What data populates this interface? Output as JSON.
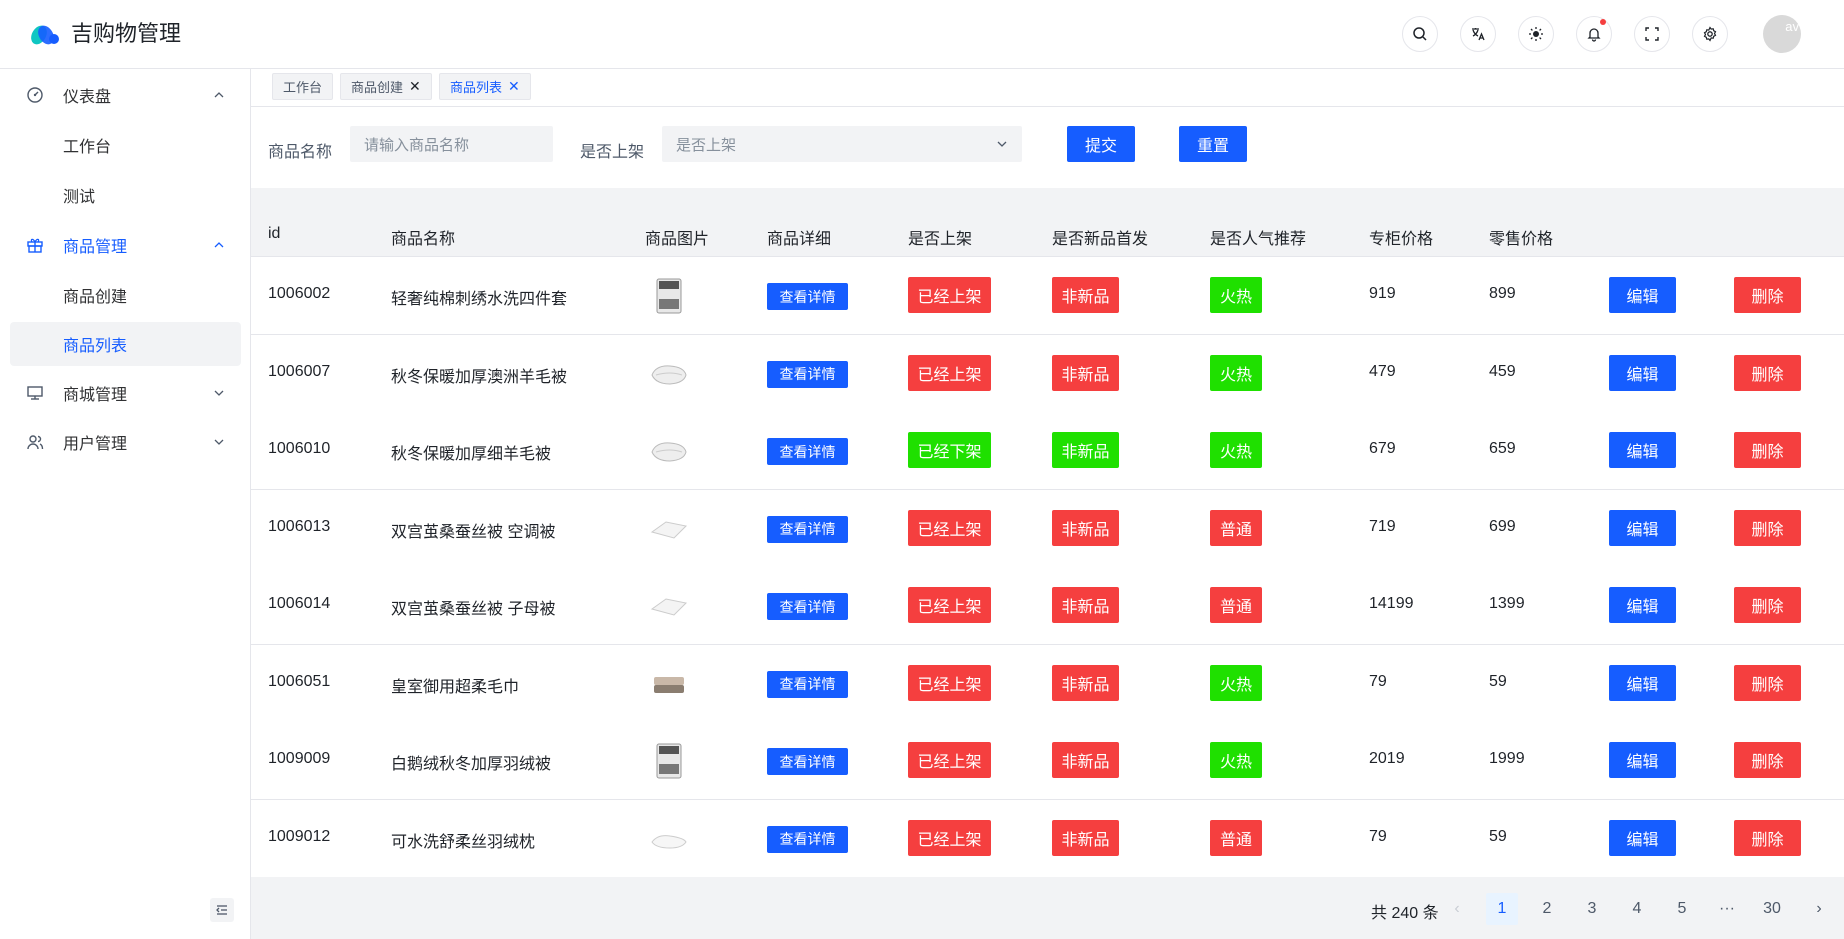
{
  "header": {
    "title": "吉购物管理",
    "avatar_alt": "av",
    "icons": [
      "search-icon",
      "translate-icon",
      "theme-icon",
      "bell-icon",
      "fullscreen-icon",
      "settings-icon"
    ]
  },
  "colors": {
    "primary": "#165dff",
    "danger": "#f53f3f",
    "success": "#1fe000"
  },
  "sidebar": {
    "items": [
      {
        "label": "仪表盘",
        "icon": "dashboard-icon",
        "expanded": true
      },
      {
        "label": "工作台",
        "sub": true
      },
      {
        "label": "测试",
        "sub": true
      },
      {
        "label": "商品管理",
        "icon": "gift-icon",
        "expanded": true,
        "active": true
      },
      {
        "label": "商品创建",
        "sub": true
      },
      {
        "label": "商品列表",
        "sub": true,
        "selected": true
      },
      {
        "label": "商城管理",
        "icon": "monitor-icon",
        "expanded": false
      },
      {
        "label": "用户管理",
        "icon": "users-icon",
        "expanded": false
      }
    ]
  },
  "tabs": [
    {
      "label": "工作台",
      "closable": false
    },
    {
      "label": "商品创建",
      "closable": true
    },
    {
      "label": "商品列表",
      "closable": true,
      "active": true
    }
  ],
  "filter": {
    "name_label": "商品名称",
    "name_placeholder": "请输入商品名称",
    "onsale_label": "是否上架",
    "onsale_placeholder": "是否上架",
    "submit": "提交",
    "reset": "重置"
  },
  "table": {
    "columns": [
      "id",
      "商品名称",
      "商品图片",
      "商品详细",
      "是否上架",
      "是否新品首发",
      "是否人气推荐",
      "专柜价格",
      "零售价格"
    ],
    "detail_label": "查看详情",
    "edit_label": "编辑",
    "delete_label": "删除",
    "rows": [
      {
        "id": "1006002",
        "name": "轻奢纯棉刺绣水洗四件套",
        "onsale": "已经上架",
        "onsale_color": "red",
        "isnew": "非新品",
        "isnew_color": "red",
        "hot": "火热",
        "hot_color": "green",
        "counter": "919",
        "retail": "899",
        "thumb": "bedding-set"
      },
      {
        "id": "1006007",
        "name": "秋冬保暖加厚澳洲羊毛被",
        "onsale": "已经上架",
        "onsale_color": "red",
        "isnew": "非新品",
        "isnew_color": "red",
        "hot": "火热",
        "hot_color": "green",
        "counter": "479",
        "retail": "459",
        "thumb": "quilt"
      },
      {
        "id": "1006010",
        "name": "秋冬保暖加厚细羊毛被",
        "onsale": "已经下架",
        "onsale_color": "green",
        "isnew": "非新品",
        "isnew_color": "green",
        "hot": "火热",
        "hot_color": "green",
        "counter": "679",
        "retail": "659",
        "thumb": "quilt"
      },
      {
        "id": "1006013",
        "name": "双宫茧桑蚕丝被 空调被",
        "onsale": "已经上架",
        "onsale_color": "red",
        "isnew": "非新品",
        "isnew_color": "red",
        "hot": "普通",
        "hot_color": "red",
        "counter": "719",
        "retail": "699",
        "thumb": "quilt-flat"
      },
      {
        "id": "1006014",
        "name": "双宫茧桑蚕丝被 子母被",
        "onsale": "已经上架",
        "onsale_color": "red",
        "isnew": "非新品",
        "isnew_color": "red",
        "hot": "普通",
        "hot_color": "red",
        "counter": "14199",
        "retail": "1399",
        "thumb": "quilt-flat"
      },
      {
        "id": "1006051",
        "name": "皇室御用超柔毛巾",
        "onsale": "已经上架",
        "onsale_color": "red",
        "isnew": "非新品",
        "isnew_color": "red",
        "hot": "火热",
        "hot_color": "green",
        "counter": "79",
        "retail": "59",
        "thumb": "towel"
      },
      {
        "id": "1009009",
        "name": "白鹅绒秋冬加厚羽绒被",
        "onsale": "已经上架",
        "onsale_color": "red",
        "isnew": "非新品",
        "isnew_color": "red",
        "hot": "火热",
        "hot_color": "green",
        "counter": "2019",
        "retail": "1999",
        "thumb": "bedding-set"
      },
      {
        "id": "1009012",
        "name": "可水洗舒柔丝羽绒枕",
        "onsale": "已经上架",
        "onsale_color": "red",
        "isnew": "非新品",
        "isnew_color": "red",
        "hot": "普通",
        "hot_color": "red",
        "counter": "79",
        "retail": "59",
        "thumb": "pillow"
      }
    ]
  },
  "pagination": {
    "total_text": "共 240 条",
    "pages": [
      "1",
      "2",
      "3",
      "4",
      "5",
      "···",
      "30"
    ],
    "current": "1",
    "prev": "‹",
    "next": "›"
  }
}
